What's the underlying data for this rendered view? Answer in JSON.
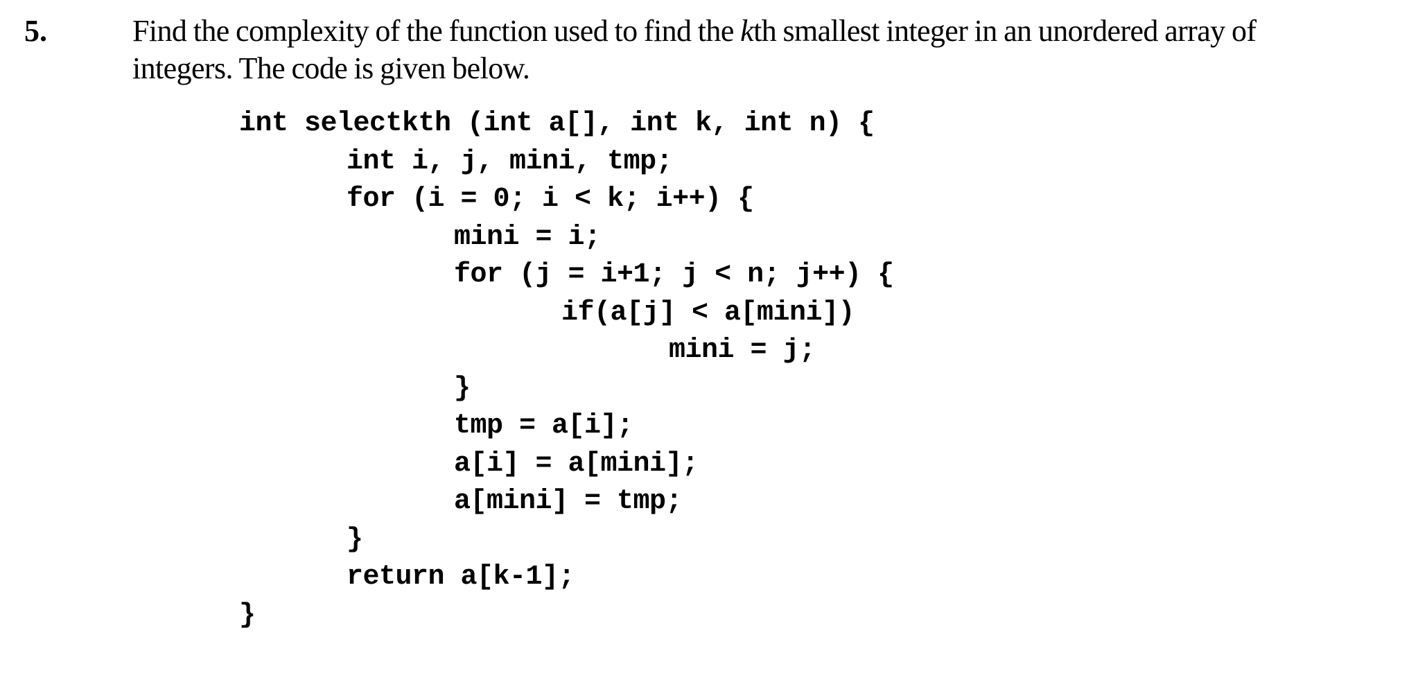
{
  "question": {
    "number": "5.",
    "prompt_line1_pre": "Find the complexity of the function used to find the ",
    "prompt_line1_italic": "k",
    "prompt_line1_post": "th smallest integer in an unordered array of",
    "prompt_line2": "integers. The code is given below."
  },
  "code": {
    "lines": [
      {
        "indent": 0,
        "text": "int selectkth (int a[], int k, int n) {"
      },
      {
        "indent": 1,
        "text": "int i, j, mini, tmp;"
      },
      {
        "indent": 1,
        "text": "for (i = 0; i < k; i++) {"
      },
      {
        "indent": 2,
        "text": "mini = i;"
      },
      {
        "indent": 2,
        "text": "for (j = i+1; j < n; j++) {"
      },
      {
        "indent": 3,
        "text": "if(a[j] < a[mini])"
      },
      {
        "indent": 4,
        "text": "mini = j;"
      },
      {
        "indent": 2,
        "text": "}"
      },
      {
        "indent": 2,
        "text": "tmp = a[i];"
      },
      {
        "indent": 2,
        "text": "a[i] = a[mini];"
      },
      {
        "indent": 2,
        "text": "a[mini] = tmp;"
      },
      {
        "indent": 1,
        "text": "}"
      },
      {
        "indent": 1,
        "text": "return a[k-1];"
      },
      {
        "indent": 0,
        "text": "}"
      }
    ]
  }
}
